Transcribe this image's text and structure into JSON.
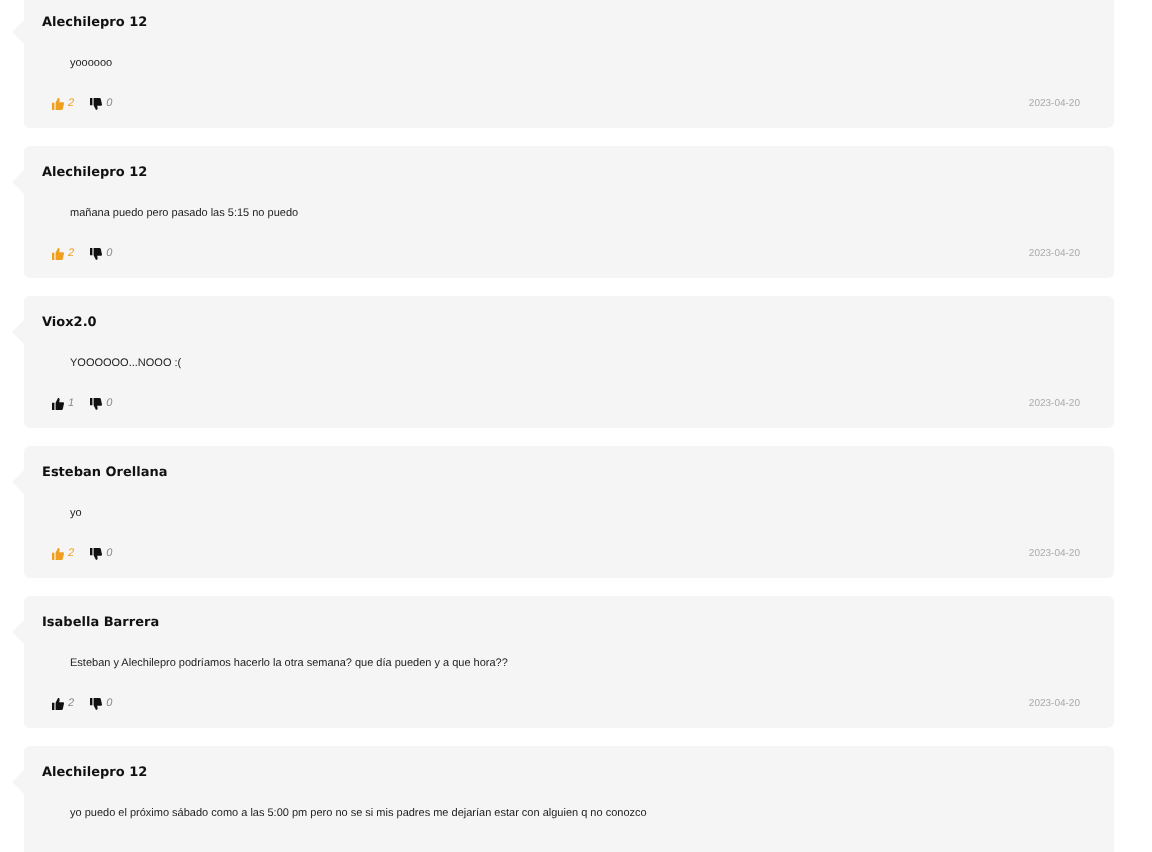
{
  "comments": [
    {
      "author": "Alechilepro 12",
      "text": "yoooooo",
      "likes": "2",
      "liked": true,
      "dislikes": "0",
      "date": "2023-04-20"
    },
    {
      "author": "Alechilepro 12",
      "text": "mañana puedo pero pasado las 5:15 no puedo",
      "likes": "2",
      "liked": true,
      "dislikes": "0",
      "date": "2023-04-20"
    },
    {
      "author": "Viox2.0",
      "text": "YOOOOOO...NOOO :(",
      "likes": "1",
      "liked": false,
      "dislikes": "0",
      "date": "2023-04-20"
    },
    {
      "author": "Esteban Orellana",
      "text": "yo",
      "likes": "2",
      "liked": true,
      "dislikes": "0",
      "date": "2023-04-20"
    },
    {
      "author": "Isabella Barrera",
      "text": "Esteban y Alechilepro podríamos hacerlo la otra semana? que día pueden y a que hora??",
      "likes": "2",
      "liked": false,
      "dislikes": "0",
      "date": "2023-04-20"
    },
    {
      "author": "Alechilepro 12",
      "text": "yo puedo el próximo sábado como a las 5:00 pm pero no se si mis padres me dejarían estar con alguien q no conozco"
    }
  ]
}
